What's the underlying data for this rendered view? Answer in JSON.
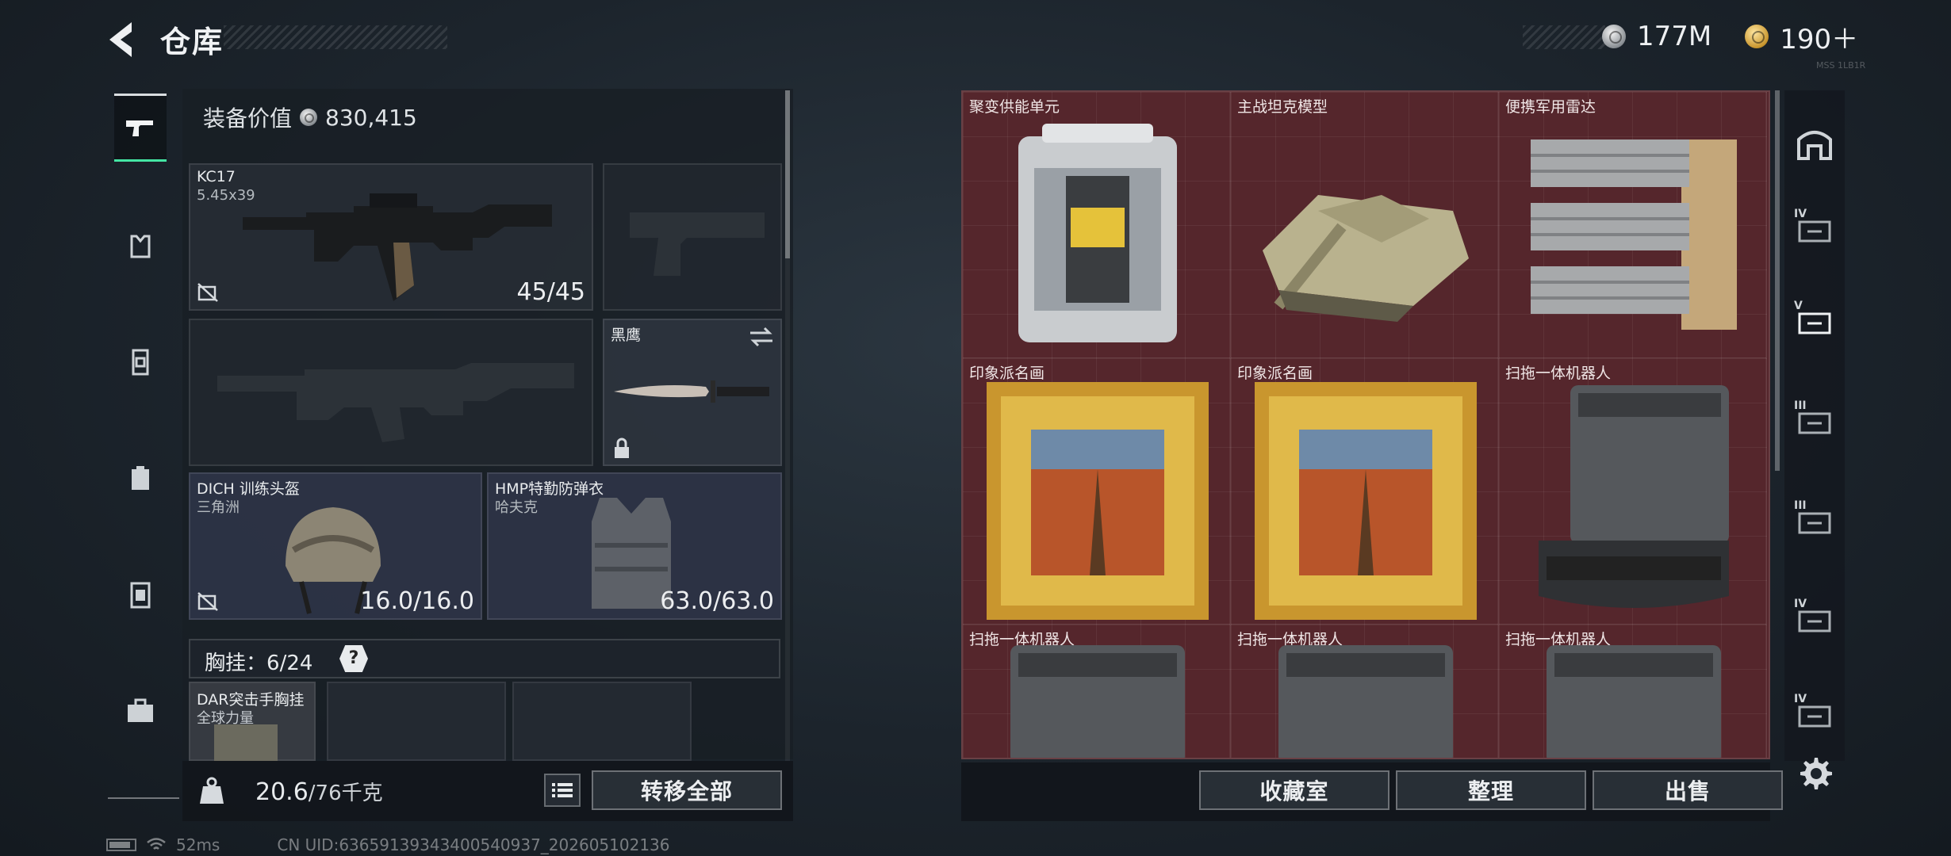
{
  "header": {
    "title": "仓库",
    "currency_silver": "177M",
    "currency_gold": "190＋",
    "small_code": "MSS 1LB1R"
  },
  "left_tabs": [
    {
      "name": "weapon",
      "active": true
    },
    {
      "name": "armor"
    },
    {
      "name": "vest"
    },
    {
      "name": "backpack"
    },
    {
      "name": "container"
    },
    {
      "name": "case"
    }
  ],
  "equipment": {
    "value_label": "装备价值",
    "value": "830,415",
    "primary_weapon": {
      "name": "KC17",
      "caliber": "5.45x39",
      "ammo": "45/45"
    },
    "melee": {
      "name": "黑鹰"
    },
    "helmet": {
      "name": "DICH 训练头盔",
      "brand": "三角洲",
      "durability": "16.0/16.0"
    },
    "armor": {
      "name": "HMP特勤防弹衣",
      "brand": "哈夫克",
      "durability": "63.0/63.0"
    },
    "chest_rig": {
      "label": "胸挂：",
      "used": "6",
      "separator": "/",
      "capacity": "24",
      "help": "?"
    },
    "chest_item": {
      "name": "DAR突击手胸挂",
      "brand": "全球力量"
    }
  },
  "weight": {
    "current": "20.6",
    "max": "/76千克"
  },
  "buttons": {
    "transfer_all": "转移全部",
    "collection": "收藏室",
    "organize": "整理",
    "sell": "出售"
  },
  "storage": [
    {
      "label": "聚变供能单元",
      "icon": "fusion-cell"
    },
    {
      "label": "主战坦克模型",
      "icon": "tank-model"
    },
    {
      "label": "便携军用雷达",
      "icon": "radar"
    },
    {
      "label": "印象派名画",
      "icon": "painting"
    },
    {
      "label": "印象派名画",
      "icon": "painting"
    },
    {
      "label": "扫拖一体机器人",
      "icon": "robot-vacuum"
    },
    {
      "label": "扫拖一体机器人",
      "icon": "robot-vacuum"
    },
    {
      "label": "扫拖一体机器人",
      "icon": "robot-vacuum"
    },
    {
      "label": "扫拖一体机器人",
      "icon": "robot-vacuum"
    }
  ],
  "right_tabs": [
    {
      "roman": ""
    },
    {
      "roman": "IV"
    },
    {
      "roman": "V"
    },
    {
      "roman": "III"
    },
    {
      "roman": "III"
    },
    {
      "roman": "IV"
    },
    {
      "roman": "IV"
    }
  ],
  "status": {
    "ping": "52ms",
    "uid": "CN UID:636591393434005409​37_202605102136"
  },
  "colors": {
    "grid_bg": "#55262c",
    "accent_green": "#44e6a4"
  }
}
